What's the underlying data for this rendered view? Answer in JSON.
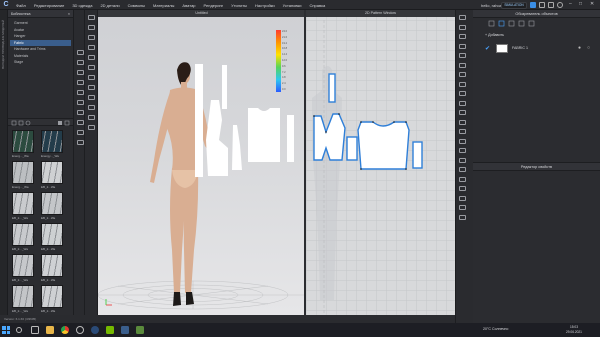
{
  "menu": [
    "Файл",
    "Редактирование",
    "3D одежда",
    "2D детали",
    "Символы",
    "Материалы",
    "Аватар",
    "Рендеринг",
    "Утилиты",
    "Настройки",
    "Установки",
    "Справка"
  ],
  "user": "hello, rahoani",
  "sim_badge": "SIMULATION",
  "left_strip_text": "ВКЛАДКИ ПРОВОДНИК МОДУЛЕЙ",
  "library": {
    "title": "Библиотека",
    "tree": [
      "Garment",
      "Avatar",
      "Hanger",
      "Fabric",
      "Hardware and Trims",
      "Materials",
      "Stage"
    ],
    "selected_index": 3,
    "thumbs": [
      {
        "caption": "Energ..._Wa",
        "color": "#2c4b3f"
      },
      {
        "caption": "Energy..._Wa",
        "color": "#233c4a"
      },
      {
        "caption": "Energ..._Wa",
        "color": "#bcbfc2"
      },
      {
        "caption": "EB_2...Wa",
        "color": "#cfd1d3"
      },
      {
        "caption": "EB_2..._Wa",
        "color": "#c9cbce"
      },
      {
        "caption": "EB_2...Wa",
        "color": "#c4c6c9"
      },
      {
        "caption": "EB_2..._Wa",
        "color": "#c8cacd"
      },
      {
        "caption": "EB_2...Wa",
        "color": "#cdd0d2"
      },
      {
        "caption": "EB_2..._Wa",
        "color": "#c6c8cb"
      },
      {
        "caption": "EB_2...Wa",
        "color": "#cfd1d4"
      },
      {
        "caption": "EB_2..._Wa",
        "color": "#c3c5c8"
      },
      {
        "caption": "EB_2...Wa",
        "color": "#ced0d3"
      }
    ]
  },
  "view3d": {
    "title": "Untitled",
    "legend_values": [
      "24.0",
      "21.6",
      "19.2",
      "16.8",
      "14.4",
      "12.0",
      "9.6",
      "7.2",
      "4.8",
      "2.4",
      "0.0"
    ]
  },
  "view2d": {
    "title": "2D Pattern Window"
  },
  "object_panel": {
    "title": "Обозреватель объектов",
    "add_label": "+ Добавить",
    "fabric_label": "FABRIC 1"
  },
  "property_panel": {
    "title": "Редактор свойств"
  },
  "status_text": "Version: 6.1.66 (r33605)",
  "taskbar": {
    "weather": "20°C  Солнечно",
    "time": "15:03",
    "date": "29.06.2021"
  },
  "colors": {
    "accent": "#4aa3ff",
    "selection": "#3a5e8c",
    "pattern_outline": "#2f7fd8"
  }
}
